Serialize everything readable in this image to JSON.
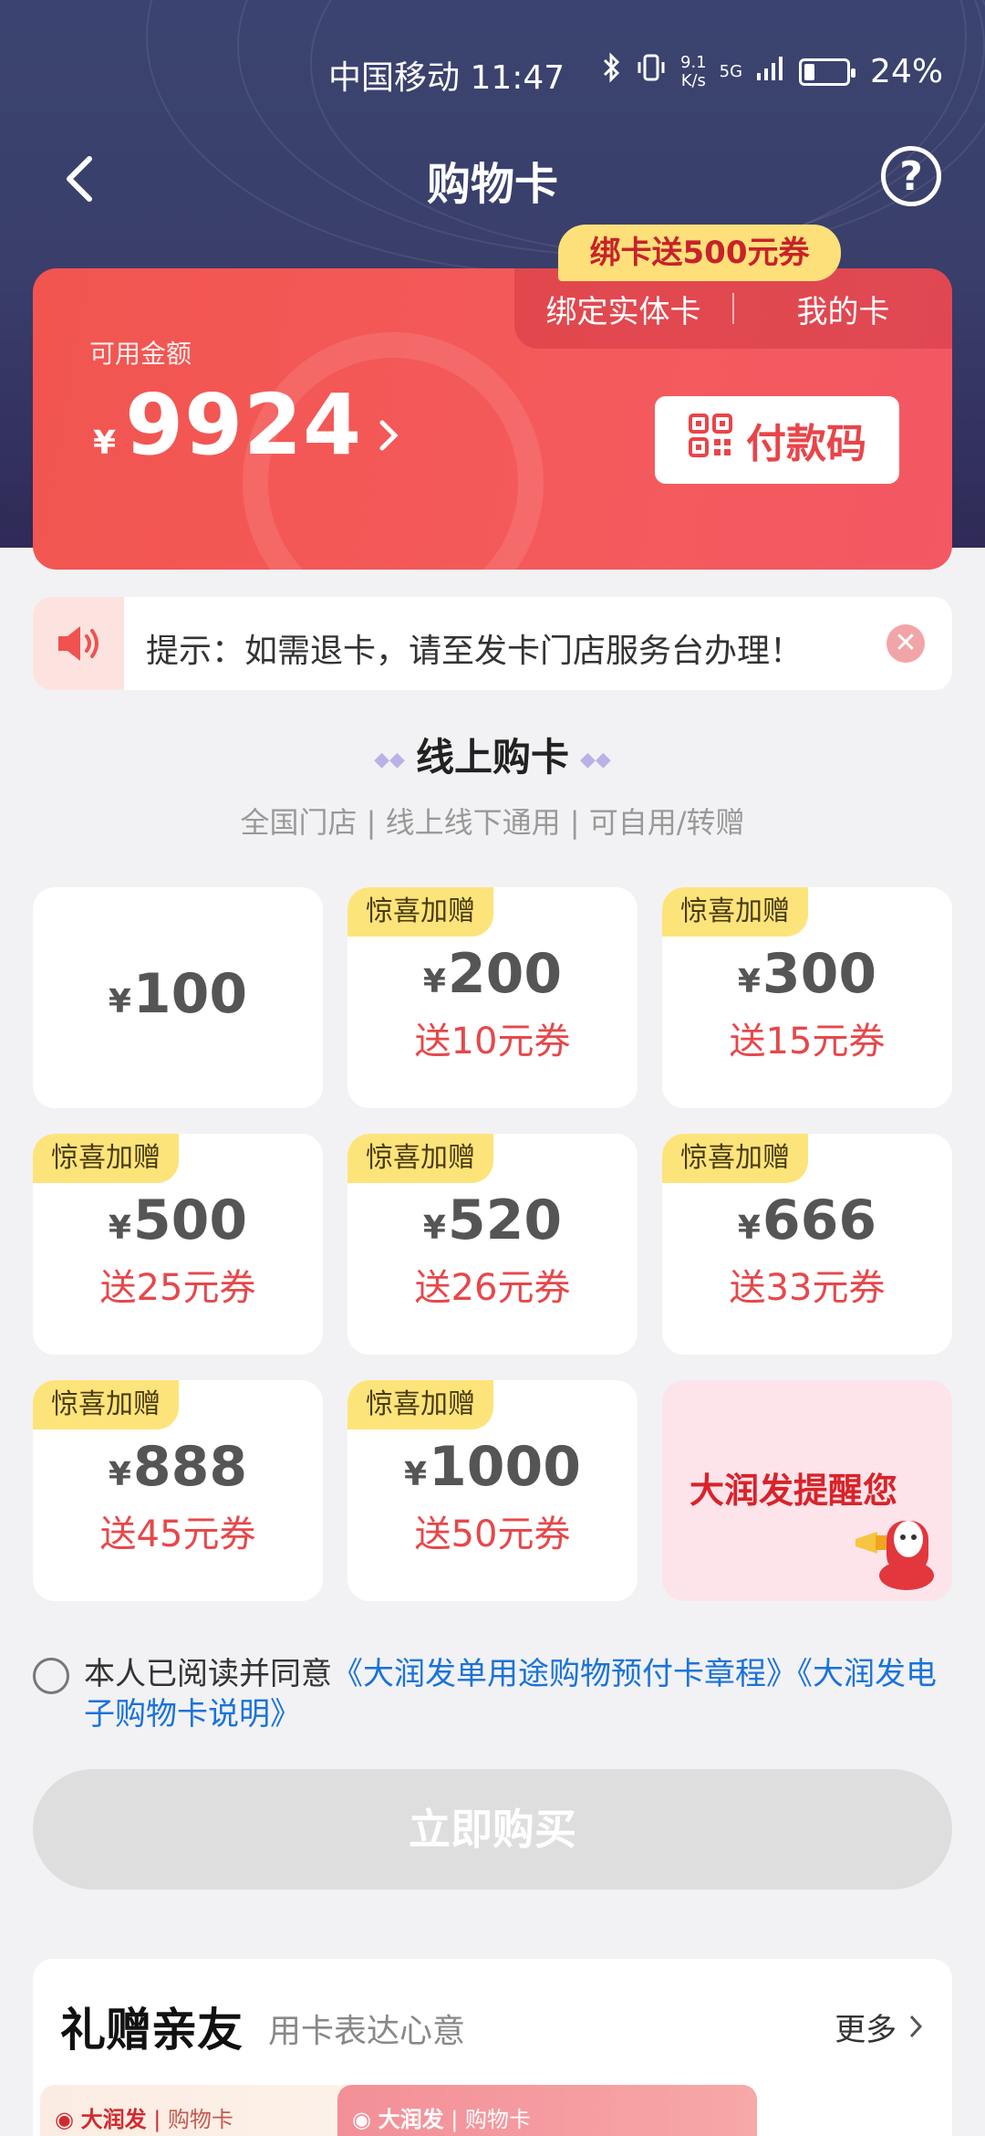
{
  "status": {
    "carrier_time": "中国移动 11:47",
    "speed_value": "9.1",
    "speed_unit": "K/s",
    "network": "5G",
    "battery_percent": 24,
    "battery_label": "24%"
  },
  "nav": {
    "title": "购物卡"
  },
  "card": {
    "promo_tag": "绑卡送500元券",
    "tab_bind": "绑定实体卡",
    "tab_mine": "我的卡",
    "available_label": "可用金额",
    "currency": "¥",
    "amount": "9924",
    "pay_code_label": "付款码"
  },
  "notice": {
    "text": "提示：如需退卡，请至发卡门店服务台办理！"
  },
  "online": {
    "title": "线上购卡",
    "subtitle": "全国门店 | 线上线下通用 | 可自用/转赠"
  },
  "tiles": [
    {
      "badge": "",
      "currency": "¥",
      "price": "100",
      "gift": ""
    },
    {
      "badge": "惊喜加赠",
      "currency": "¥",
      "price": "200",
      "gift": "送10元券"
    },
    {
      "badge": "惊喜加赠",
      "currency": "¥",
      "price": "300",
      "gift": "送15元券"
    },
    {
      "badge": "惊喜加赠",
      "currency": "¥",
      "price": "500",
      "gift": "送25元券"
    },
    {
      "badge": "惊喜加赠",
      "currency": "¥",
      "price": "520",
      "gift": "送26元券"
    },
    {
      "badge": "惊喜加赠",
      "currency": "¥",
      "price": "666",
      "gift": "送33元券"
    },
    {
      "badge": "惊喜加赠",
      "currency": "¥",
      "price": "888",
      "gift": "送45元券"
    },
    {
      "badge": "惊喜加赠",
      "currency": "¥",
      "price": "1000",
      "gift": "送50元券"
    }
  ],
  "remind": {
    "text": "大润发提醒您"
  },
  "agreement": {
    "prefix": "本人已阅读并同意",
    "link1": "《大润发单用途购物预付卡章程》",
    "link2": "《大润发电子购物卡说明》"
  },
  "buy_button": "立即购买",
  "gift_section": {
    "title": "礼赠亲友",
    "subtitle": "用卡表达心意",
    "more": "更多",
    "card_brand": "大润发",
    "card_type": "购物卡"
  },
  "colors": {
    "header_bg": "#3a3e6a",
    "card_red": "#f2554f",
    "promo_yellow": "#fde07a",
    "badge_yellow": "#fde47a",
    "gift_red": "#e6484b",
    "link_blue": "#1a73d9",
    "buy_disabled": "#dedede"
  }
}
